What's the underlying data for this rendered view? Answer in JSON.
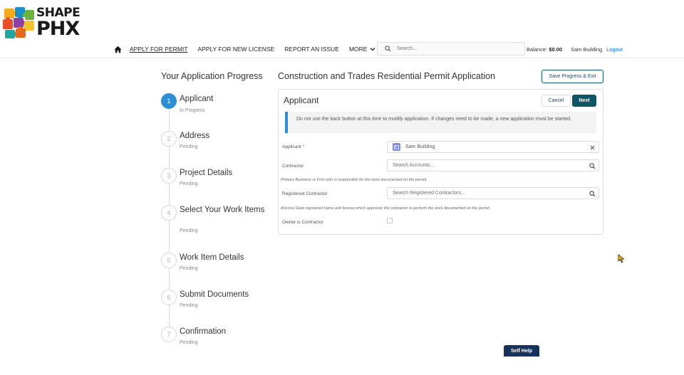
{
  "brand": {
    "line1": "SHAPE",
    "line2": "PHX"
  },
  "nav": {
    "items": [
      {
        "label": "APPLY FOR PERMIT",
        "active": true
      },
      {
        "label": "APPLY FOR NEW LICENSE",
        "active": false
      },
      {
        "label": "REPORT AN ISSUE",
        "active": false
      }
    ],
    "more_label": "MORE"
  },
  "search": {
    "placeholder": "Search..."
  },
  "account": {
    "balance_label": "Balance:",
    "balance_value": "$0.00",
    "user_name": "Sam Building",
    "logout_label": "Logout"
  },
  "progress": {
    "title": "Your Application Progress",
    "steps": [
      {
        "number": "1",
        "title": "Applicant",
        "status": "In Progress"
      },
      {
        "number": "2",
        "title": "Address",
        "status": "Pending"
      },
      {
        "number": "3",
        "title": "Project Details",
        "status": "Pending"
      },
      {
        "number": "4",
        "title": "Select Your Work Items",
        "status": "Pending"
      },
      {
        "number": "5",
        "title": "Work Item Details",
        "status": "Pending"
      },
      {
        "number": "6",
        "title": "Submit Documents",
        "status": "Pending"
      },
      {
        "number": "7",
        "title": "Confirmation",
        "status": "Pending"
      }
    ]
  },
  "application": {
    "title": "Construction and Trades Residential Permit Application",
    "save_exit_label": "Save Progress & Exit"
  },
  "card": {
    "title": "Applicant",
    "cancel_label": "Cancel",
    "next_label": "Next",
    "notice": "Do not use the back button at this time to modify application. If changes need to be made, a new application must be started.",
    "fields": {
      "applicant": {
        "label": "Applicant",
        "required_mark": "*",
        "value": "Sam Building"
      },
      "contractor": {
        "label": "Contractor",
        "placeholder": "Search Accounts...",
        "help": "Primary Business or Firm who is responsible for the work documented on the permit."
      },
      "registered_contractor": {
        "label": "Registered Contractor",
        "placeholder": "Search Registered Contractors...",
        "help": "Arizona State registered name and license which approves the contractor to perform the work documented on the permit."
      },
      "owner_is_contractor": {
        "label": "Owner is Contractor",
        "checked": false
      }
    }
  },
  "self_help_label": "Self Help",
  "colors": {
    "accent": "#2c8fd6",
    "primary_button": "#0e5565",
    "link": "#0070d2",
    "self_help_bg": "#16325c"
  }
}
